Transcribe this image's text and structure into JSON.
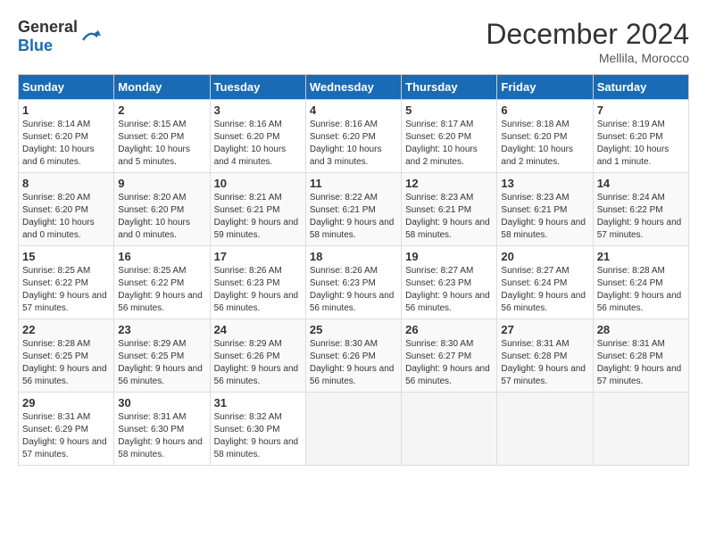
{
  "header": {
    "logo_general": "General",
    "logo_blue": "Blue",
    "month_title": "December 2024",
    "location": "Mellila, Morocco"
  },
  "calendar": {
    "days_of_week": [
      "Sunday",
      "Monday",
      "Tuesday",
      "Wednesday",
      "Thursday",
      "Friday",
      "Saturday"
    ],
    "weeks": [
      [
        {
          "day": "1",
          "sunrise": "8:14 AM",
          "sunset": "6:20 PM",
          "daylight": "10 hours and 6 minutes."
        },
        {
          "day": "2",
          "sunrise": "8:15 AM",
          "sunset": "6:20 PM",
          "daylight": "10 hours and 5 minutes."
        },
        {
          "day": "3",
          "sunrise": "8:16 AM",
          "sunset": "6:20 PM",
          "daylight": "10 hours and 4 minutes."
        },
        {
          "day": "4",
          "sunrise": "8:16 AM",
          "sunset": "6:20 PM",
          "daylight": "10 hours and 3 minutes."
        },
        {
          "day": "5",
          "sunrise": "8:17 AM",
          "sunset": "6:20 PM",
          "daylight": "10 hours and 2 minutes."
        },
        {
          "day": "6",
          "sunrise": "8:18 AM",
          "sunset": "6:20 PM",
          "daylight": "10 hours and 2 minutes."
        },
        {
          "day": "7",
          "sunrise": "8:19 AM",
          "sunset": "6:20 PM",
          "daylight": "10 hours and 1 minute."
        }
      ],
      [
        {
          "day": "8",
          "sunrise": "8:20 AM",
          "sunset": "6:20 PM",
          "daylight": "10 hours and 0 minutes."
        },
        {
          "day": "9",
          "sunrise": "8:20 AM",
          "sunset": "6:20 PM",
          "daylight": "10 hours and 0 minutes."
        },
        {
          "day": "10",
          "sunrise": "8:21 AM",
          "sunset": "6:21 PM",
          "daylight": "9 hours and 59 minutes."
        },
        {
          "day": "11",
          "sunrise": "8:22 AM",
          "sunset": "6:21 PM",
          "daylight": "9 hours and 58 minutes."
        },
        {
          "day": "12",
          "sunrise": "8:23 AM",
          "sunset": "6:21 PM",
          "daylight": "9 hours and 58 minutes."
        },
        {
          "day": "13",
          "sunrise": "8:23 AM",
          "sunset": "6:21 PM",
          "daylight": "9 hours and 58 minutes."
        },
        {
          "day": "14",
          "sunrise": "8:24 AM",
          "sunset": "6:22 PM",
          "daylight": "9 hours and 57 minutes."
        }
      ],
      [
        {
          "day": "15",
          "sunrise": "8:25 AM",
          "sunset": "6:22 PM",
          "daylight": "9 hours and 57 minutes."
        },
        {
          "day": "16",
          "sunrise": "8:25 AM",
          "sunset": "6:22 PM",
          "daylight": "9 hours and 56 minutes."
        },
        {
          "day": "17",
          "sunrise": "8:26 AM",
          "sunset": "6:23 PM",
          "daylight": "9 hours and 56 minutes."
        },
        {
          "day": "18",
          "sunrise": "8:26 AM",
          "sunset": "6:23 PM",
          "daylight": "9 hours and 56 minutes."
        },
        {
          "day": "19",
          "sunrise": "8:27 AM",
          "sunset": "6:23 PM",
          "daylight": "9 hours and 56 minutes."
        },
        {
          "day": "20",
          "sunrise": "8:27 AM",
          "sunset": "6:24 PM",
          "daylight": "9 hours and 56 minutes."
        },
        {
          "day": "21",
          "sunrise": "8:28 AM",
          "sunset": "6:24 PM",
          "daylight": "9 hours and 56 minutes."
        }
      ],
      [
        {
          "day": "22",
          "sunrise": "8:28 AM",
          "sunset": "6:25 PM",
          "daylight": "9 hours and 56 minutes."
        },
        {
          "day": "23",
          "sunrise": "8:29 AM",
          "sunset": "6:25 PM",
          "daylight": "9 hours and 56 minutes."
        },
        {
          "day": "24",
          "sunrise": "8:29 AM",
          "sunset": "6:26 PM",
          "daylight": "9 hours and 56 minutes."
        },
        {
          "day": "25",
          "sunrise": "8:30 AM",
          "sunset": "6:26 PM",
          "daylight": "9 hours and 56 minutes."
        },
        {
          "day": "26",
          "sunrise": "8:30 AM",
          "sunset": "6:27 PM",
          "daylight": "9 hours and 56 minutes."
        },
        {
          "day": "27",
          "sunrise": "8:31 AM",
          "sunset": "6:28 PM",
          "daylight": "9 hours and 57 minutes."
        },
        {
          "day": "28",
          "sunrise": "8:31 AM",
          "sunset": "6:28 PM",
          "daylight": "9 hours and 57 minutes."
        }
      ],
      [
        {
          "day": "29",
          "sunrise": "8:31 AM",
          "sunset": "6:29 PM",
          "daylight": "9 hours and 57 minutes."
        },
        {
          "day": "30",
          "sunrise": "8:31 AM",
          "sunset": "6:30 PM",
          "daylight": "9 hours and 58 minutes."
        },
        {
          "day": "31",
          "sunrise": "8:32 AM",
          "sunset": "6:30 PM",
          "daylight": "9 hours and 58 minutes."
        },
        null,
        null,
        null,
        null
      ]
    ]
  }
}
